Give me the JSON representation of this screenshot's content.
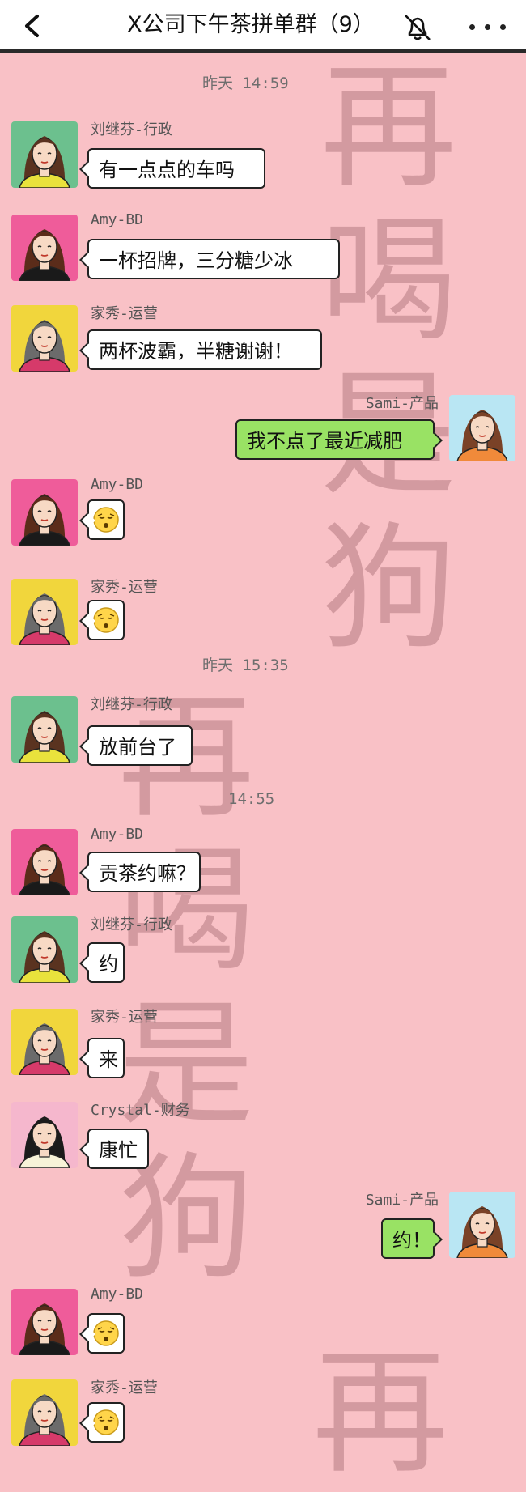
{
  "header": {
    "back_icon": "chevron-left-icon",
    "title": "X公司下午茶拼单群（9）",
    "mute_icon": "bell-off-icon",
    "more_icon": "ellipsis-icon"
  },
  "watermark": {
    "column_right": [
      "再",
      "喝",
      "是",
      "狗"
    ],
    "column_left": [
      "再",
      "喝",
      "是",
      "狗"
    ],
    "column_bottom": [
      "再"
    ]
  },
  "timestamps": [
    "昨天 14:59",
    "昨天 15:35",
    "14:55"
  ],
  "messages": [
    {
      "sender": "刘继芬-行政",
      "text": "有一点点的车吗",
      "self": false,
      "avatar": "avatar-green"
    },
    {
      "sender": "Amy-BD",
      "text": "一杯招牌，三分糖少冰",
      "self": false,
      "avatar": "avatar-pink"
    },
    {
      "sender": "家秀-运营",
      "text": "两杯波霸，半糖谢谢！",
      "self": false,
      "avatar": "avatar-yellow"
    },
    {
      "sender": "Sami-产品",
      "text": "我不点了最近减肥",
      "self": true,
      "avatar": "avatar-blue"
    },
    {
      "sender": "Amy-BD",
      "text": "",
      "self": false,
      "avatar": "avatar-pink",
      "emoji": "sleepy-face-emoji"
    },
    {
      "sender": "家秀-运营",
      "text": "",
      "self": false,
      "avatar": "avatar-yellow",
      "emoji": "sleepy-face-emoji"
    },
    {
      "sender": "刘继芬-行政",
      "text": "放前台了",
      "self": false,
      "avatar": "avatar-green"
    },
    {
      "sender": "Amy-BD",
      "text": "贡茶约嘛？",
      "self": false,
      "avatar": "avatar-pink"
    },
    {
      "sender": "刘继芬-行政",
      "text": "约",
      "self": false,
      "avatar": "avatar-green"
    },
    {
      "sender": "家秀-运营",
      "text": "来",
      "self": false,
      "avatar": "avatar-yellow"
    },
    {
      "sender": "Crystal-财务",
      "text": "康忙",
      "self": false,
      "avatar": "avatar-lightpink"
    },
    {
      "sender": "Sami-产品",
      "text": "约！",
      "self": true,
      "avatar": "avatar-blue"
    },
    {
      "sender": "Amy-BD",
      "text": "",
      "self": false,
      "avatar": "avatar-pink",
      "emoji": "sleepy-face-emoji"
    },
    {
      "sender": "家秀-运营",
      "text": "",
      "self": false,
      "avatar": "avatar-yellow",
      "emoji": "sleepy-face-emoji"
    }
  ],
  "colors": {
    "background": "#f9c1c6",
    "self_bubble": "#99e264",
    "other_bubble": "#ffffff",
    "watermark": "#a0646c"
  }
}
